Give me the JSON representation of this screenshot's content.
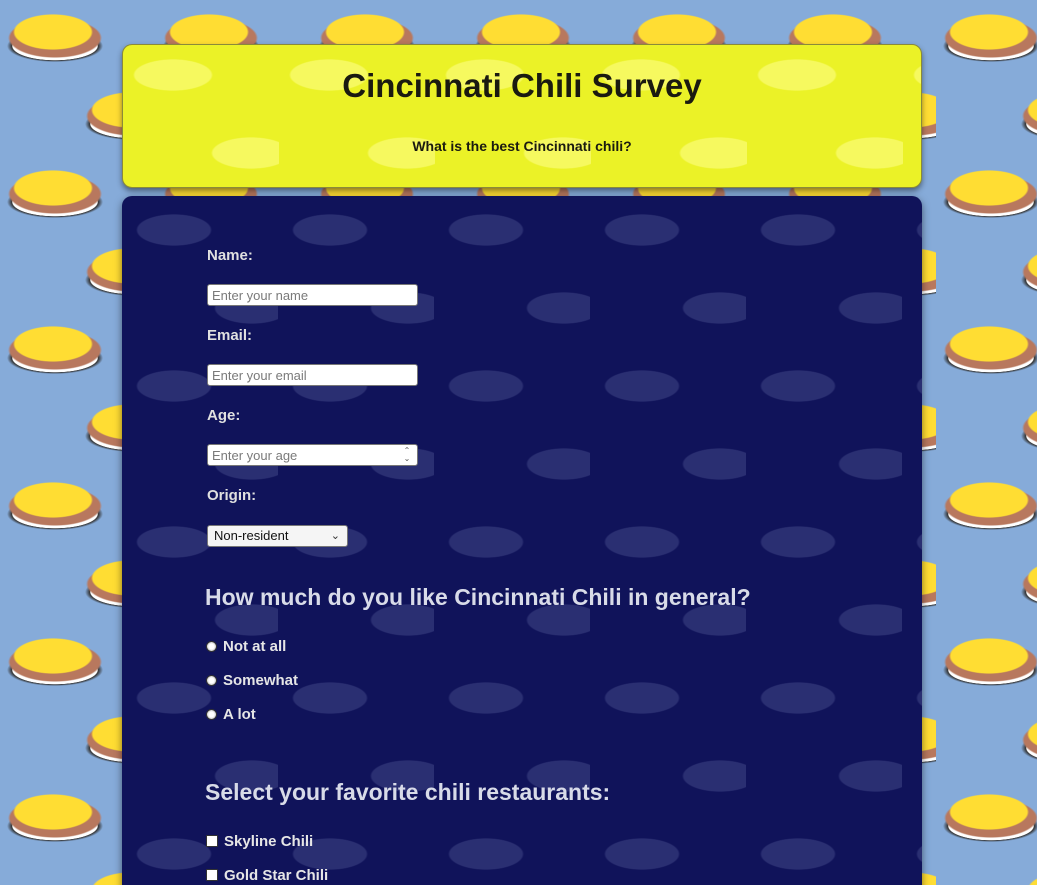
{
  "header": {
    "title": "Cincinnati Chili Survey",
    "subtitle": "What is the best Cincinnati chili?"
  },
  "form": {
    "name": {
      "label": "Name:",
      "placeholder": "Enter your name",
      "value": ""
    },
    "email": {
      "label": "Email:",
      "placeholder": "Enter your email",
      "value": ""
    },
    "age": {
      "label": "Age:",
      "placeholder": "Enter your age",
      "value": ""
    },
    "origin": {
      "label": "Origin:",
      "selected": "Non-resident"
    },
    "like_section": {
      "title": "How much do you like Cincinnati Chili in general?",
      "options": [
        {
          "label": "Not at all",
          "checked": false
        },
        {
          "label": "Somewhat",
          "checked": false
        },
        {
          "label": "A lot",
          "checked": false
        }
      ]
    },
    "restaurants_section": {
      "title": "Select your favorite chili restaurants:",
      "options": [
        {
          "label": "Skyline Chili",
          "checked": false
        },
        {
          "label": "Gold Star Chili",
          "checked": false
        }
      ]
    }
  },
  "colors": {
    "page_background": "#86abd9",
    "header_background": "#ebf227",
    "form_background": "#10135a",
    "header_text": "#1a1a10",
    "form_text": "#e6e6e6"
  },
  "icons": {
    "spinner": "number-spinner-icon",
    "select_chevron": "chevron-down-icon"
  }
}
